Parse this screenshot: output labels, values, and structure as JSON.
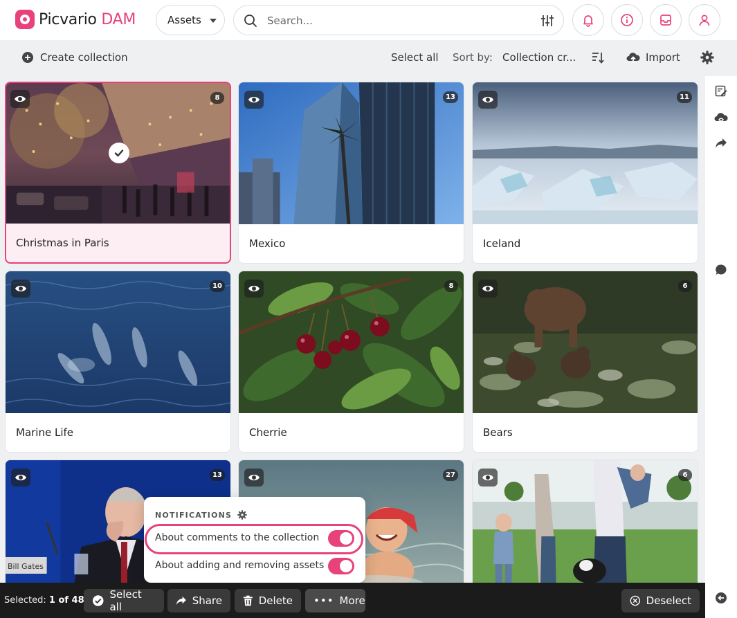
{
  "header": {
    "logo_main": "Picvario",
    "logo_accent": "DAM",
    "scope_select": "Assets",
    "search_placeholder": "Search..."
  },
  "toolbar": {
    "create_collection": "Create collection",
    "select_all": "Select all",
    "sort_label": "Sort by:",
    "sort_value": "Collection cr...",
    "import": "Import"
  },
  "collections": [
    {
      "title": "Christmas in Paris",
      "count": "8",
      "selected": true
    },
    {
      "title": "Mexico",
      "count": "13"
    },
    {
      "title": "Iceland",
      "count": "11"
    },
    {
      "title": "Marine Life",
      "count": "10"
    },
    {
      "title": "Cherrie",
      "count": "8"
    },
    {
      "title": "Bears",
      "count": "6"
    },
    {
      "title": "",
      "count": "13",
      "image_caption": "Bill Gates"
    },
    {
      "title": "",
      "count": "27"
    },
    {
      "title": "",
      "count": "6"
    }
  ],
  "notifications": {
    "title": "NOTIFICATIONS",
    "items": [
      {
        "label": "About comments to the collection",
        "enabled": true
      },
      {
        "label": "About adding and removing assets",
        "enabled": true
      }
    ]
  },
  "bottombar": {
    "selected_prefix": "Selected:",
    "selected_count": "1 of 48",
    "select_all": "Select all",
    "share": "Share",
    "delete": "Delete",
    "more": "More",
    "deselect": "Deselect"
  },
  "colors": {
    "accent": "#e8417c",
    "bottombar": "#1b1b1b"
  }
}
